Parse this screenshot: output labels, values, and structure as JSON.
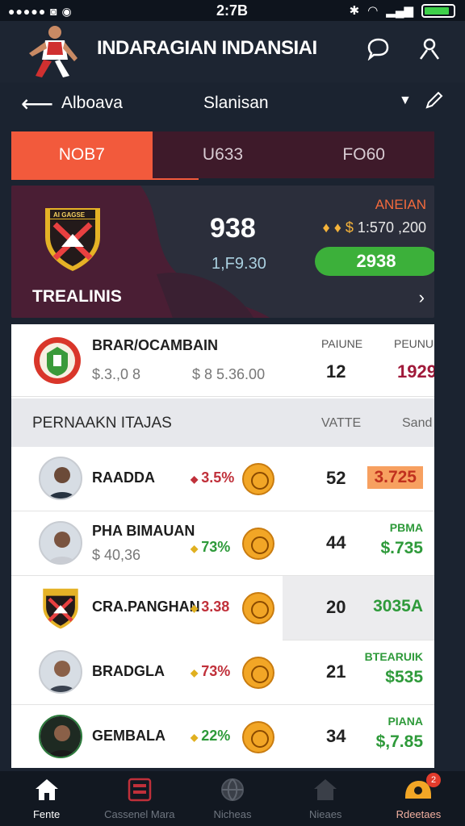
{
  "status_bar": {
    "time": "2:7B"
  },
  "header": {
    "title": "INDARAGIAN INDANSIAI"
  },
  "nav": {
    "back_label": "Alboava",
    "center_label": "Slanisan"
  },
  "tabs": [
    {
      "label": "NOB7",
      "active": true
    },
    {
      "label": "U633",
      "active": false
    },
    {
      "label": "FO60",
      "active": false
    }
  ],
  "team_card": {
    "crest_text": "AI GAGSE",
    "name": "TREALINIS",
    "score": "938",
    "sub": "1,F9.30",
    "right_label": "ANEIAN",
    "right_value": "1:570 ,200",
    "pill": "2938"
  },
  "summary_row": {
    "title": "BRAR/OCAMBAIN",
    "value1": "$.3.,0 8",
    "value2": "$ 8 5.36.00",
    "col1_header": "PAIUNE",
    "col2_header": "PEUNUE",
    "col1_value": "12",
    "col2_value": "1929"
  },
  "section": {
    "title": "PERNAAKN ITAJAS",
    "col1": "VATTE",
    "col2": "Sand"
  },
  "rows": [
    {
      "name": "RAADDA",
      "sub": "",
      "pct": "3.5%",
      "dir": "down",
      "num": "52",
      "rlabel": "",
      "rval": "3.725",
      "style": "orange"
    },
    {
      "name": "PHA BIMAUAN",
      "sub": "$ 40,36",
      "pct": "73%",
      "dir": "up",
      "num": "44",
      "rlabel": "PBMA",
      "rval": "$.735",
      "style": "green"
    },
    {
      "name": "CRA.PANGHAN",
      "sub": "",
      "pct": "3.38",
      "dir": "up",
      "num": "20",
      "rlabel": "",
      "rval": "3035A",
      "style": "green"
    },
    {
      "name": "BRADGLA",
      "sub": "",
      "pct": "73%",
      "dir": "up",
      "num": "21",
      "rlabel": "BTEARUIK",
      "rval": "$535",
      "style": "green"
    },
    {
      "name": "GEMBALA",
      "sub": "",
      "pct": "22%",
      "dir": "up",
      "num": "34",
      "rlabel": "PIANA",
      "rval": "$,7.85",
      "style": "green"
    }
  ],
  "bottom_nav": [
    {
      "label": "Fente",
      "icon": "home-icon"
    },
    {
      "label": "Cassenel Mara",
      "icon": "calendar-icon"
    },
    {
      "label": "Nicheas",
      "icon": "globe-icon"
    },
    {
      "label": "Nieaes",
      "icon": "house-icon"
    },
    {
      "label": "Rdeetaes",
      "icon": "helmet-icon",
      "badge": "2"
    }
  ],
  "colors": {
    "accent": "#f25a3c",
    "green": "#3cb03a",
    "tab_bg": "#3e1a2a",
    "bg": "#1b2330"
  }
}
